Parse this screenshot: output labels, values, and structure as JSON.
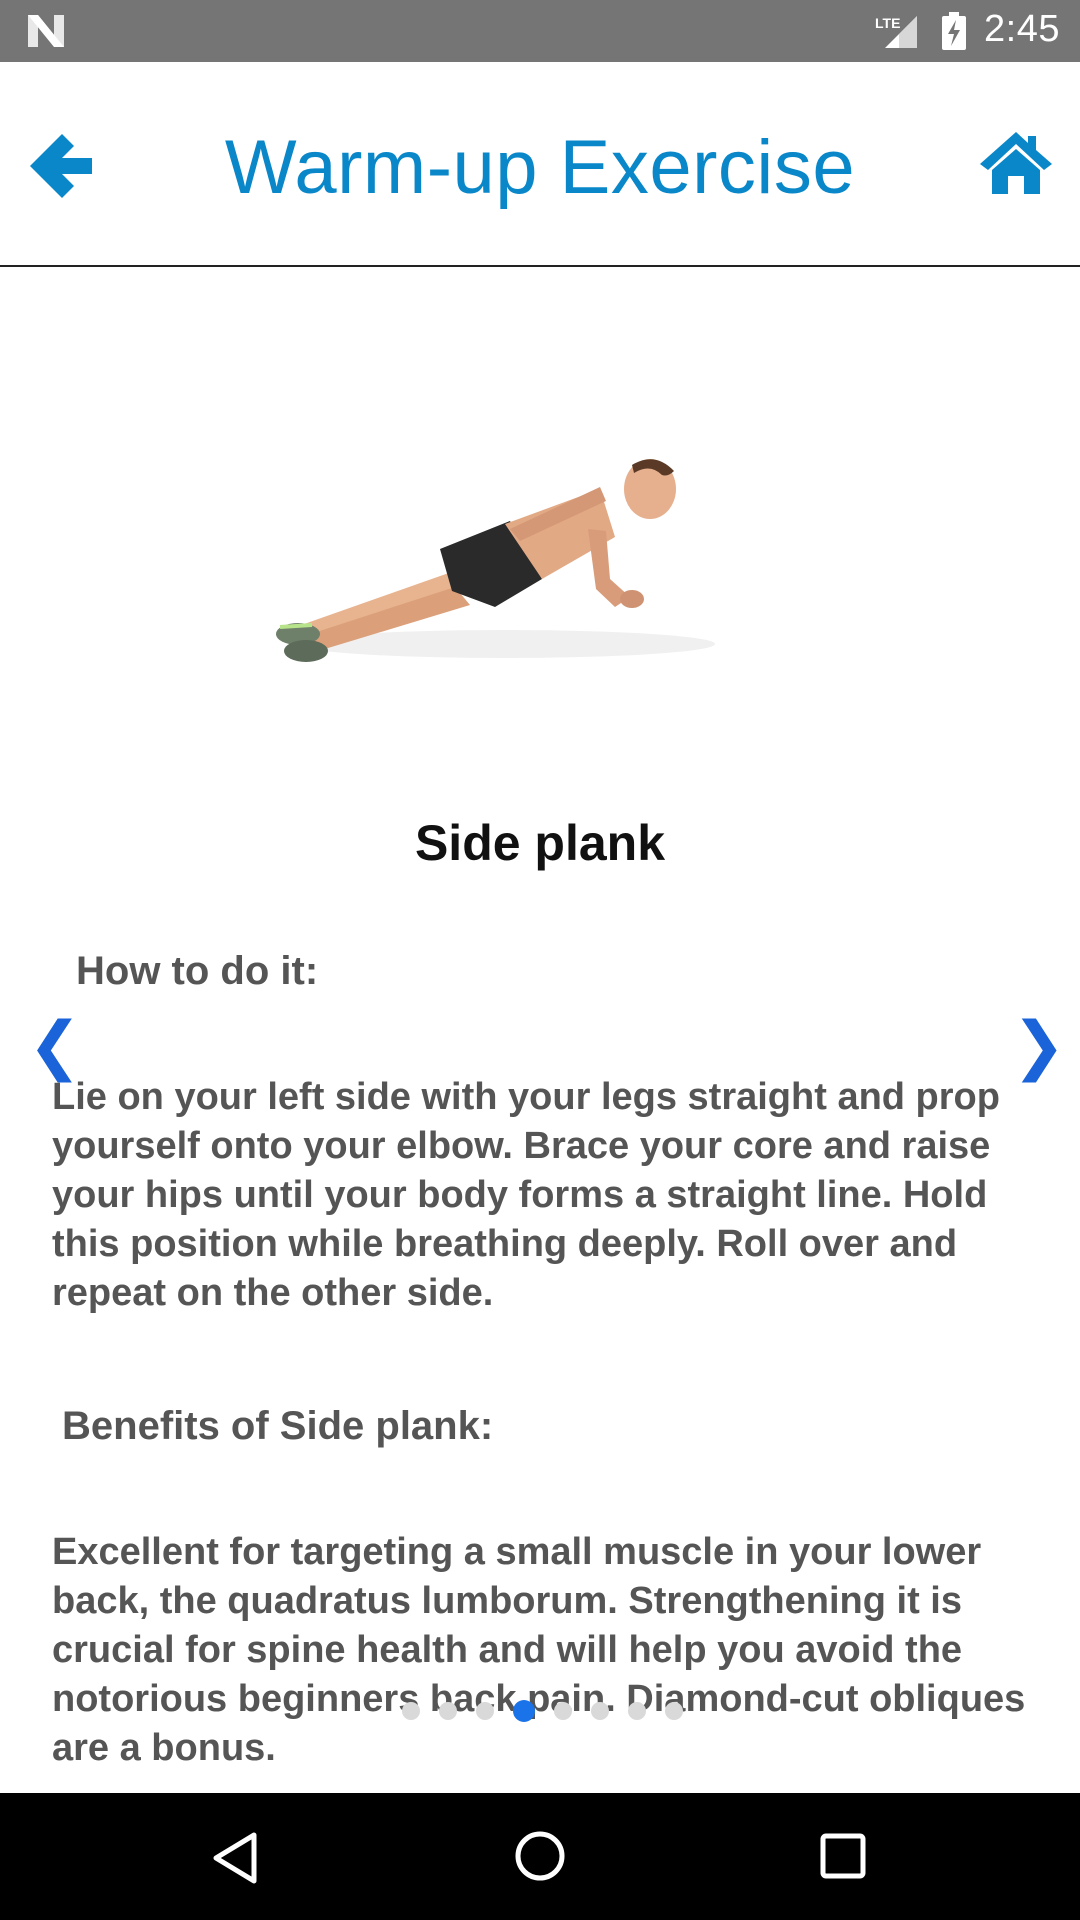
{
  "status_bar": {
    "time": "2:45",
    "network_label": "LTE",
    "icons": [
      "n-logo-icon",
      "signal-icon",
      "battery-charging-icon"
    ]
  },
  "header": {
    "title": "Warm-up Exercise",
    "back_icon": "arrow-left-icon",
    "home_icon": "home-icon",
    "accent_color": "#0a87c9"
  },
  "exercise": {
    "name": "Side plank",
    "how_heading": "How to do it:",
    "how_text": "Lie on your left side with your legs straight and prop yourself onto your elbow. Brace your core and raise your hips until your body forms a straight line. Hold this position while breathing deeply. Roll over and repeat on the other side.",
    "benefits_heading": "Benefits of Side plank:",
    "benefits_text": "Excellent for targeting a small muscle in your lower back, the quadratus lumborum. Strengthening it is crucial for spine health and will help you avoid the notorious beginners back pain. Diamond-cut obliques are a bonus."
  },
  "pager": {
    "prev_arrow": "❮",
    "next_arrow": "❯",
    "total_pages": 8,
    "current_page": 4,
    "active_color": "#1a73e8"
  },
  "nav_bar": {
    "icons": [
      "nav-back-icon",
      "nav-home-icon",
      "nav-recents-icon"
    ]
  }
}
